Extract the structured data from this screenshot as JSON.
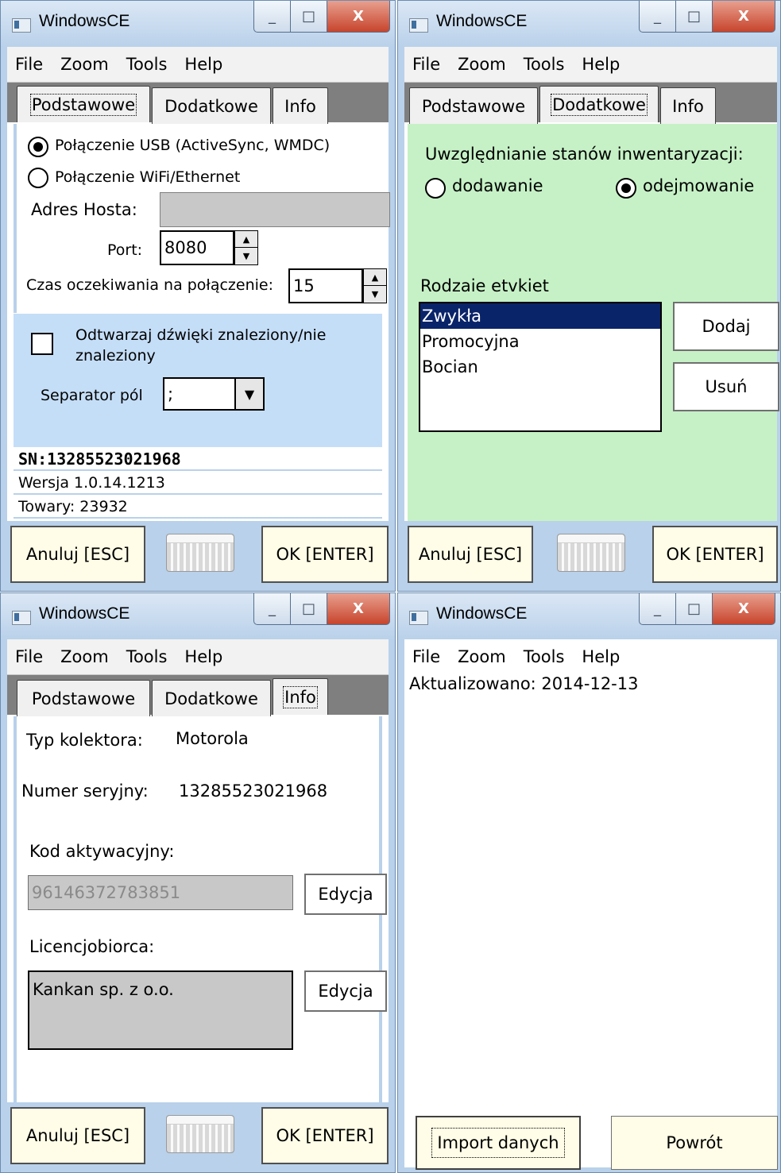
{
  "windows": {
    "title": "WindowsCE",
    "caption": {
      "minimize": "_",
      "maximize": "□",
      "close": "X"
    },
    "menu": [
      "File",
      "Zoom",
      "Tools",
      "Help"
    ]
  },
  "tabs": {
    "basic": "Podstawowe",
    "extra": "Dodatkowe",
    "info": "Info"
  },
  "footer": {
    "cancel": "Anuluj [ESC]",
    "ok": "OK [ENTER]"
  },
  "basic": {
    "usb_label": "Połączenie USB (ActiveSync, WMDC)",
    "wifi_label": "Połączenie  WiFi/Ethernet",
    "host_label": "Adres Hosta:",
    "host_value": "",
    "port_label": "Port:",
    "port_value": "8080",
    "timeout_label": "Czas oczekiwania na połączenie:",
    "timeout_value": "15",
    "sound_label_1": "Odtwarzaj dźwięki znaleziony/nie",
    "sound_label_2": "znaleziony",
    "separator_label": "Separator pól",
    "separator_value": ";",
    "sn": "SN:13285523021968",
    "version": "Wersja 1.0.14.1213",
    "goods": "Towary: 23932"
  },
  "extra": {
    "inventory_label": "Uwzględnianie stanów inwentaryzacji:",
    "add_option": "dodawanie",
    "subtract_option": "odejmowanie",
    "labels_heading": "Rodzaie etvkiet",
    "label_types": [
      "Zwykła",
      "Promocyjna",
      "Bocian"
    ],
    "add_button": "Dodaj",
    "remove_button": "Usuń"
  },
  "info": {
    "collector_label": "Typ kolektora:",
    "collector_value": "Motorola",
    "serial_label": "Numer seryjny:",
    "serial_value": "13285523021968",
    "activation_label": "Kod aktywacyjny:",
    "activation_value": "96146372783851",
    "licensee_label": "Licencjobiorca:",
    "licensee_value": "Kankan sp. z o.o.",
    "edit_button": "Edycja"
  },
  "import": {
    "updated": "Aktualizowano: 2014-12-13",
    "import_button": "Import danych",
    "back_button": "Powrót"
  },
  "colors": {
    "frame": "#b9d1ea",
    "extra_panel": "#c6f1c6",
    "selection": "#0a246a",
    "button_face": "#fffde7"
  }
}
